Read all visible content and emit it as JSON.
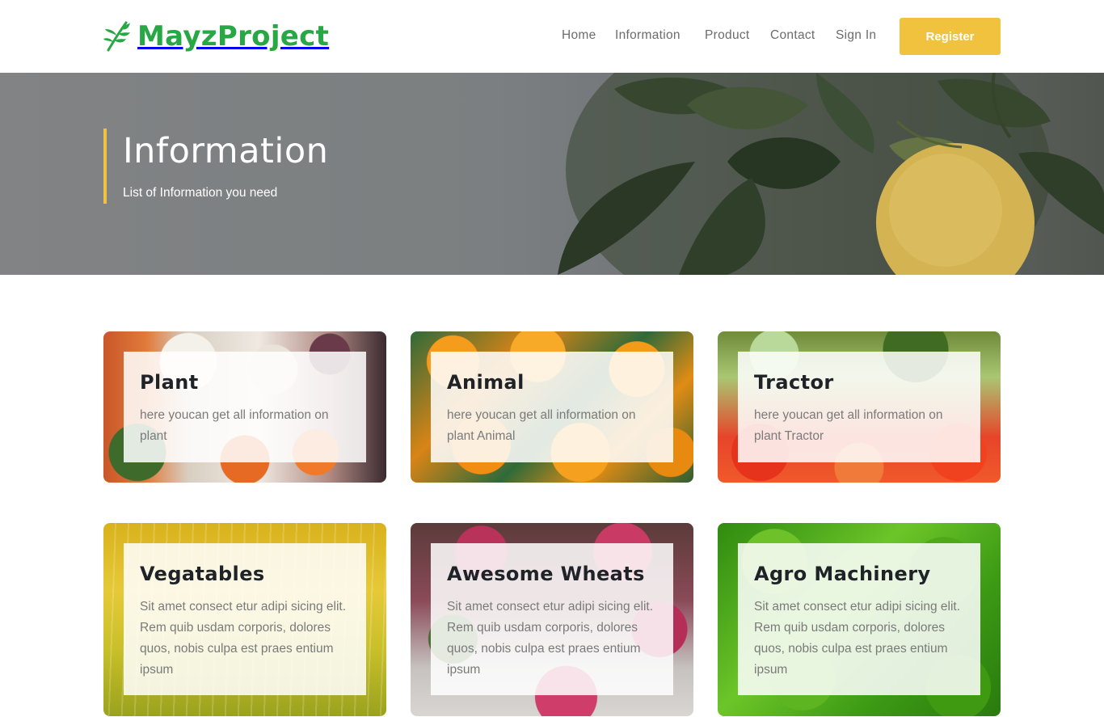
{
  "brand": {
    "name": "MayzProject",
    "icon": "leaf-icon",
    "color": "#28a745"
  },
  "nav": {
    "items": [
      {
        "label": "Home"
      },
      {
        "label": "Information"
      },
      {
        "label": "Product"
      },
      {
        "label": "Contact"
      },
      {
        "label": "Sign In"
      }
    ],
    "register_label": "Register"
  },
  "hero": {
    "title": "Information",
    "subtitle": "List of Information you need"
  },
  "cards": [
    {
      "title": "Plant",
      "text": "here youcan get all information on plant"
    },
    {
      "title": "Animal",
      "text": "here youcan get all information on plant Animal"
    },
    {
      "title": "Tractor",
      "text": "here youcan get all information on plant Tractor"
    },
    {
      "title": "Vegatables",
      "text": "Sit amet consect etur adipi sicing elit. Rem quib usdam corporis, dolores quos, nobis culpa est praes entium ipsum"
    },
    {
      "title": "Awesome Wheats",
      "text": "Sit amet consect etur adipi sicing elit. Rem quib usdam corporis, dolores quos, nobis culpa est praes entium ipsum"
    },
    {
      "title": "Agro Machinery",
      "text": "Sit amet consect etur adipi sicing elit. Rem quib usdam corporis, dolores quos, nobis culpa est praes entium ipsum"
    }
  ],
  "colors": {
    "accent": "#f0c23d",
    "brand": "#28a745"
  }
}
